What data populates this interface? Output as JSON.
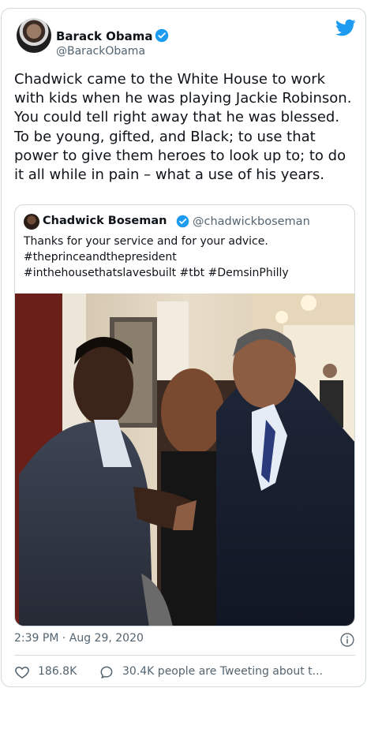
{
  "author": {
    "name": "Barack Obama",
    "handle": "@BarackObama"
  },
  "tweet": {
    "text": "Chadwick came to the White House to work with kids when he was playing Jackie Robinson. You could tell right away that he was blessed. To be young, gifted, and Black; to use that power to give them heroes to look up to; to do it all while in pain – what a use of his years."
  },
  "quoted_tweet": {
    "name": "Chadwick Boseman",
    "handle": "@chadwickboseman",
    "text_lines": [
      "Thanks for your service and for your advice.",
      "#theprinceandthepresident",
      "#inthehousethatslavesbuilt #tbt #DemsinPhilly"
    ]
  },
  "footer": {
    "timestamp": "2:39 PM · Aug 29, 2020",
    "like_count": "186.8K",
    "reply_text": "30.4K people are Tweeting about t..."
  },
  "colors": {
    "twitter_blue": "#1d9bf0",
    "secondary_text": "#536471",
    "border": "#cfd9de"
  },
  "icons": [
    "verified-badge-icon",
    "twitter-bird-icon",
    "info-icon",
    "heart-icon",
    "reply-bubble-icon"
  ]
}
